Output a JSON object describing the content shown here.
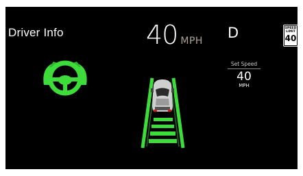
{
  "header": {
    "title": "Driver Info"
  },
  "speedometer": {
    "value": "40",
    "unit": "MPH"
  },
  "gear": {
    "value": "D"
  },
  "speed_limit": {
    "label_line1": "SPEED",
    "label_line2": "LIMIT",
    "value": "40"
  },
  "set_speed": {
    "label": "Set Speed",
    "value": "40",
    "unit": "MPH"
  },
  "icons": {
    "hands_on_wheel": "steering-wheel-hands-icon",
    "vehicle": "car-icon"
  },
  "colors": {
    "background": "#000000",
    "accent_green": "#3ddc3a",
    "text": "#ffffff",
    "unit_text": "#b0a19a"
  }
}
